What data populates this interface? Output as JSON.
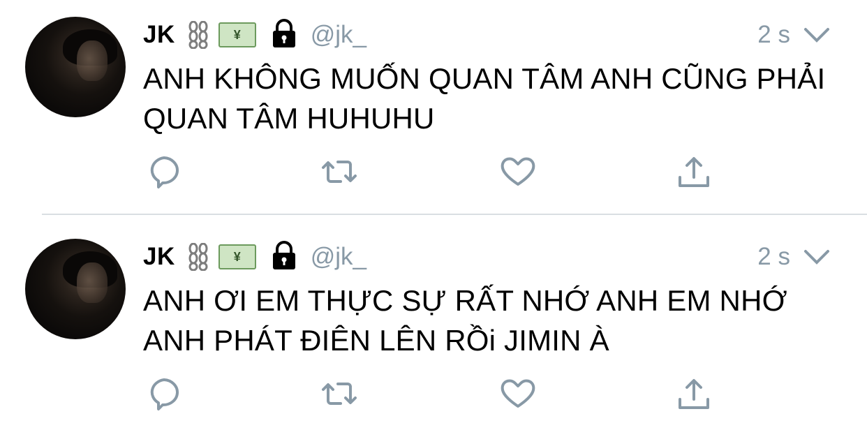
{
  "tweets": [
    {
      "name": "JK",
      "emoji_money_symbol": "¥",
      "handle": "@jk_",
      "time": "2 s",
      "text": "ANH KHÔNG MUỐN QUAN TÂM ANH CŨNG PHẢI QUAN TÂM HUHUHU"
    },
    {
      "name": "JK",
      "emoji_money_symbol": "¥",
      "handle": "@jk_",
      "time": "2 s",
      "text": "ANH ƠI EM THỰC SỰ RẤT NHỚ ANH EM NHỚ ANH PHÁT ĐIÊN LÊN RỒi JIMIN À"
    }
  ],
  "icons": [
    "chain-icon",
    "money-icon",
    "lock-icon",
    "chevron-down-icon",
    "reply-icon",
    "retweet-icon",
    "like-icon",
    "share-icon"
  ],
  "colors": {
    "secondary_text": "#8899a6",
    "divider": "#d9dee2"
  }
}
